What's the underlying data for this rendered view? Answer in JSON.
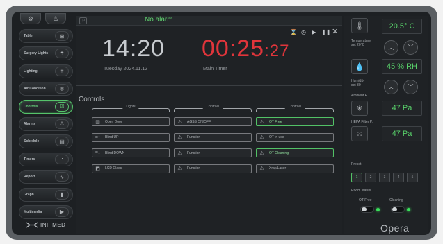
{
  "sidebar": {
    "top_icons": [
      {
        "name": "settings-icon",
        "glyph": "⚙"
      },
      {
        "name": "user-icon",
        "glyph": "♙"
      }
    ],
    "items": [
      {
        "label": "Table",
        "icon": "table-icon",
        "glyph": "⊞",
        "active": false
      },
      {
        "label": "Surgery Lights",
        "icon": "surgery-light-icon",
        "glyph": "☂",
        "active": false
      },
      {
        "label": "Lighting",
        "icon": "lighting-icon",
        "glyph": "✳",
        "active": false
      },
      {
        "label": "Air Condition",
        "icon": "snowflake-icon",
        "glyph": "❄",
        "active": false
      },
      {
        "label": "Controls",
        "icon": "controls-icon",
        "glyph": "☑",
        "active": true
      },
      {
        "label": "Alarms",
        "icon": "alarm-icon",
        "glyph": "⚠",
        "active": false
      },
      {
        "label": "Schedule",
        "icon": "schedule-icon",
        "glyph": "▤",
        "active": false
      },
      {
        "label": "Timers",
        "icon": "timer-icon",
        "glyph": "◔",
        "active": false
      },
      {
        "label": "Report",
        "icon": "report-icon",
        "glyph": "∿",
        "active": false
      },
      {
        "label": "Graph",
        "icon": "graph-icon",
        "glyph": "▮",
        "active": false
      },
      {
        "label": "Multimedia",
        "icon": "multimedia-icon",
        "glyph": "▶",
        "active": false
      }
    ],
    "logo_text": "INFIMED"
  },
  "topbar": {
    "alarm_text": "No alarm"
  },
  "clock": {
    "time": "14:20",
    "date": "Tuesday 2024.11.12",
    "timer_main": "00:25",
    "timer_sec": ":27",
    "timer_label": "Main Timer",
    "controls": [
      "⌛",
      "◷",
      "▶",
      "❚❚",
      "✕"
    ]
  },
  "controls": {
    "title": "Controls",
    "columns": [
      {
        "heading": "Lights",
        "buttons": [
          {
            "label": "Open Door",
            "icon": "door-icon",
            "glyph": "▥",
            "green": false
          },
          {
            "label": "Blind UP",
            "icon": "blind-up-icon",
            "glyph": "≡↑",
            "green": false
          },
          {
            "label": "Blind DOWN",
            "icon": "blind-down-icon",
            "glyph": "≡↓",
            "green": false
          },
          {
            "label": "LCD Glass",
            "icon": "lcd-glass-icon",
            "glyph": "◩",
            "green": false
          }
        ]
      },
      {
        "heading": "Controls",
        "buttons": [
          {
            "label": "AGSS ON/OFF",
            "icon": "warning-icon",
            "glyph": "⚠",
            "green": false
          },
          {
            "label": "Function",
            "icon": "warning-icon",
            "glyph": "⚠",
            "green": false
          },
          {
            "label": "Function",
            "icon": "warning-icon",
            "glyph": "⚠",
            "green": false
          },
          {
            "label": "Function",
            "icon": "warning-icon",
            "glyph": "⚠",
            "green": false
          }
        ]
      },
      {
        "heading": "Controls",
        "buttons": [
          {
            "label": "OT Free",
            "icon": "warning-icon",
            "glyph": "⚠",
            "green": true
          },
          {
            "label": "OT in use",
            "icon": "warning-icon",
            "glyph": "⚠",
            "green": false
          },
          {
            "label": "OT Cleaning",
            "icon": "warning-icon",
            "glyph": "⚠",
            "green": true
          },
          {
            "label": "Xray/Laser",
            "icon": "warning-icon",
            "glyph": "⚠",
            "green": false
          }
        ]
      }
    ]
  },
  "right": {
    "temperature_label_1": "Temperature",
    "temperature_label_2": "set 20°C",
    "temperature_value": "20.5° C",
    "humidity_label_1": "Humidity",
    "humidity_label_2": "set 30",
    "humidity_value": "45 % RH",
    "ambient_label": "Ambient P.",
    "ambient_value": "47 Pa",
    "hepa_label": "HEPA Filter P.",
    "hepa_value": "47 Pa",
    "preset_label": "Preset",
    "presets": [
      "1",
      "2",
      "3",
      "4",
      "5"
    ],
    "active_preset": "1",
    "room_status_label": "Room status",
    "status_left": "OT Free",
    "status_right": "Cleaning",
    "led_color": "#39e05a",
    "brand": "Opera"
  },
  "colors": {
    "accent_green": "#56c36b",
    "timer_red": "#e0353b"
  }
}
